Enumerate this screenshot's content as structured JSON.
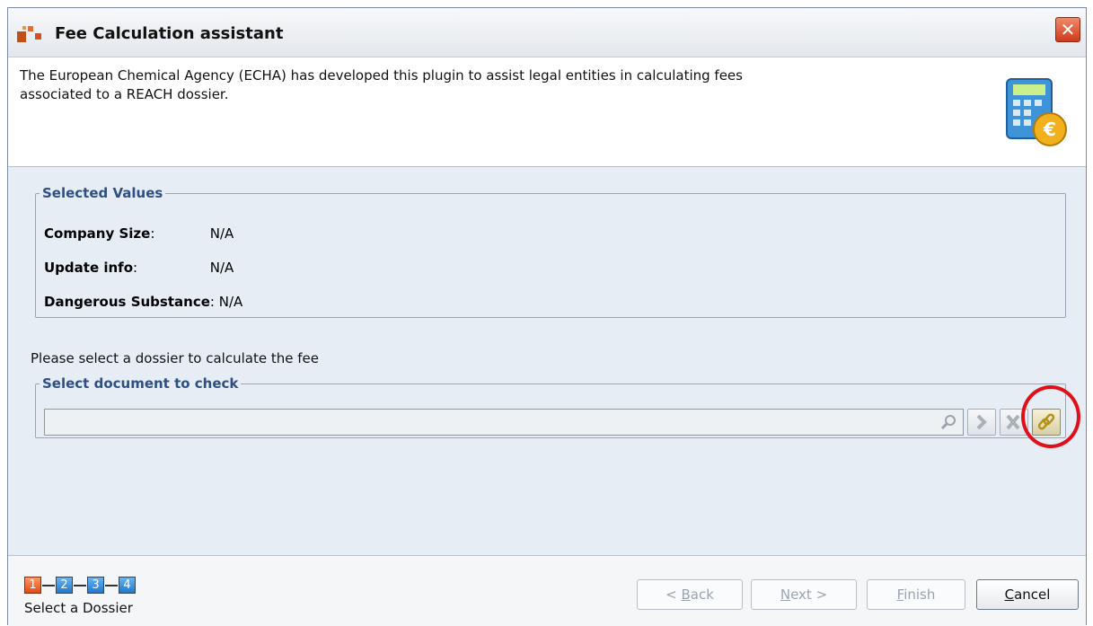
{
  "window": {
    "title": "Fee Calculation assistant",
    "close_glyph": "✕"
  },
  "header": {
    "intro_line1": "The European Chemical Agency (ECHA) has developed this plugin to assist legal entities in calculating fees",
    "intro_line2": "associated to a REACH dossier."
  },
  "selected_values": {
    "legend": "Selected Values",
    "rows": [
      {
        "label": "Company Size",
        "value": "N/A"
      },
      {
        "label": "Update info",
        "value": "N/A"
      },
      {
        "label": "Dangerous Substance",
        "value": "N/A"
      }
    ]
  },
  "prompt": "Please select a dossier to calculate the fee",
  "document_group": {
    "legend": "Select document to check",
    "value": "",
    "icons": [
      "search-icon",
      "arrow-right-icon",
      "clear-icon",
      "link-icon"
    ]
  },
  "steps": {
    "items": [
      "1",
      "2",
      "3",
      "4"
    ],
    "current": 1,
    "caption": "Select a Dossier"
  },
  "buttons": {
    "back_prefix": "< ",
    "back_mnemonic": "B",
    "back_rest": "ack",
    "next_mnemonic": "N",
    "next_rest": "ext >",
    "finish_mnemonic": "F",
    "finish_rest": "inish",
    "cancel_mnemonic": "C",
    "cancel_rest": "ancel"
  },
  "colors": {
    "content_bg": "#e6edf5",
    "legend": "#2f4f82",
    "highlight": "#e0101a",
    "step_active": "#e24a14",
    "step_inactive": "#1f78cf"
  }
}
